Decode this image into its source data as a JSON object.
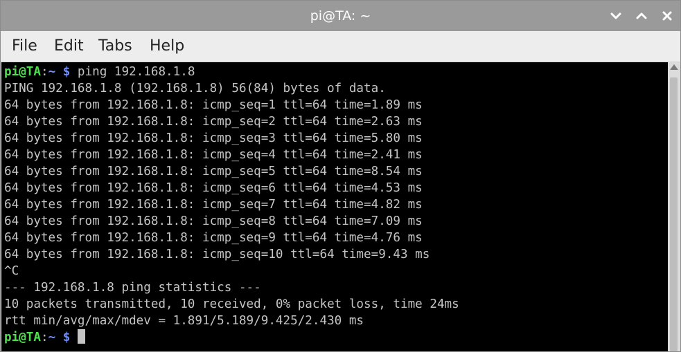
{
  "window": {
    "title": "pi@TA: ~",
    "controls": [
      "minimize-icon",
      "maximize-icon",
      "close-icon"
    ]
  },
  "menu": {
    "file": "File",
    "edit": "Edit",
    "tabs": "Tabs",
    "help": "Help"
  },
  "terminal": {
    "prompt": {
      "user_host": "pi@TA",
      "colon": ":",
      "path": "~",
      "dollar": "$"
    },
    "command": " ping 192.168.1.8",
    "lines": [
      "PING 192.168.1.8 (192.168.1.8) 56(84) bytes of data.",
      "64 bytes from 192.168.1.8: icmp_seq=1 ttl=64 time=1.89 ms",
      "64 bytes from 192.168.1.8: icmp_seq=2 ttl=64 time=2.63 ms",
      "64 bytes from 192.168.1.8: icmp_seq=3 ttl=64 time=5.80 ms",
      "64 bytes from 192.168.1.8: icmp_seq=4 ttl=64 time=2.41 ms",
      "64 bytes from 192.168.1.8: icmp_seq=5 ttl=64 time=8.54 ms",
      "64 bytes from 192.168.1.8: icmp_seq=6 ttl=64 time=4.53 ms",
      "64 bytes from 192.168.1.8: icmp_seq=7 ttl=64 time=4.82 ms",
      "64 bytes from 192.168.1.8: icmp_seq=8 ttl=64 time=7.09 ms",
      "64 bytes from 192.168.1.8: icmp_seq=9 ttl=64 time=4.76 ms",
      "64 bytes from 192.168.1.8: icmp_seq=10 ttl=64 time=9.43 ms",
      "^C",
      "--- 192.168.1.8 ping statistics ---",
      "10 packets transmitted, 10 received, 0% packet loss, time 24ms",
      "rtt min/avg/max/mdev = 1.891/5.189/9.425/2.430 ms"
    ]
  },
  "colors": {
    "titlebar": "#9a9a9a",
    "terminal_bg": "#000000",
    "terminal_fg": "#c4c4c4",
    "prompt_user": "#4ee04e",
    "prompt_path": "#6f8fff"
  }
}
